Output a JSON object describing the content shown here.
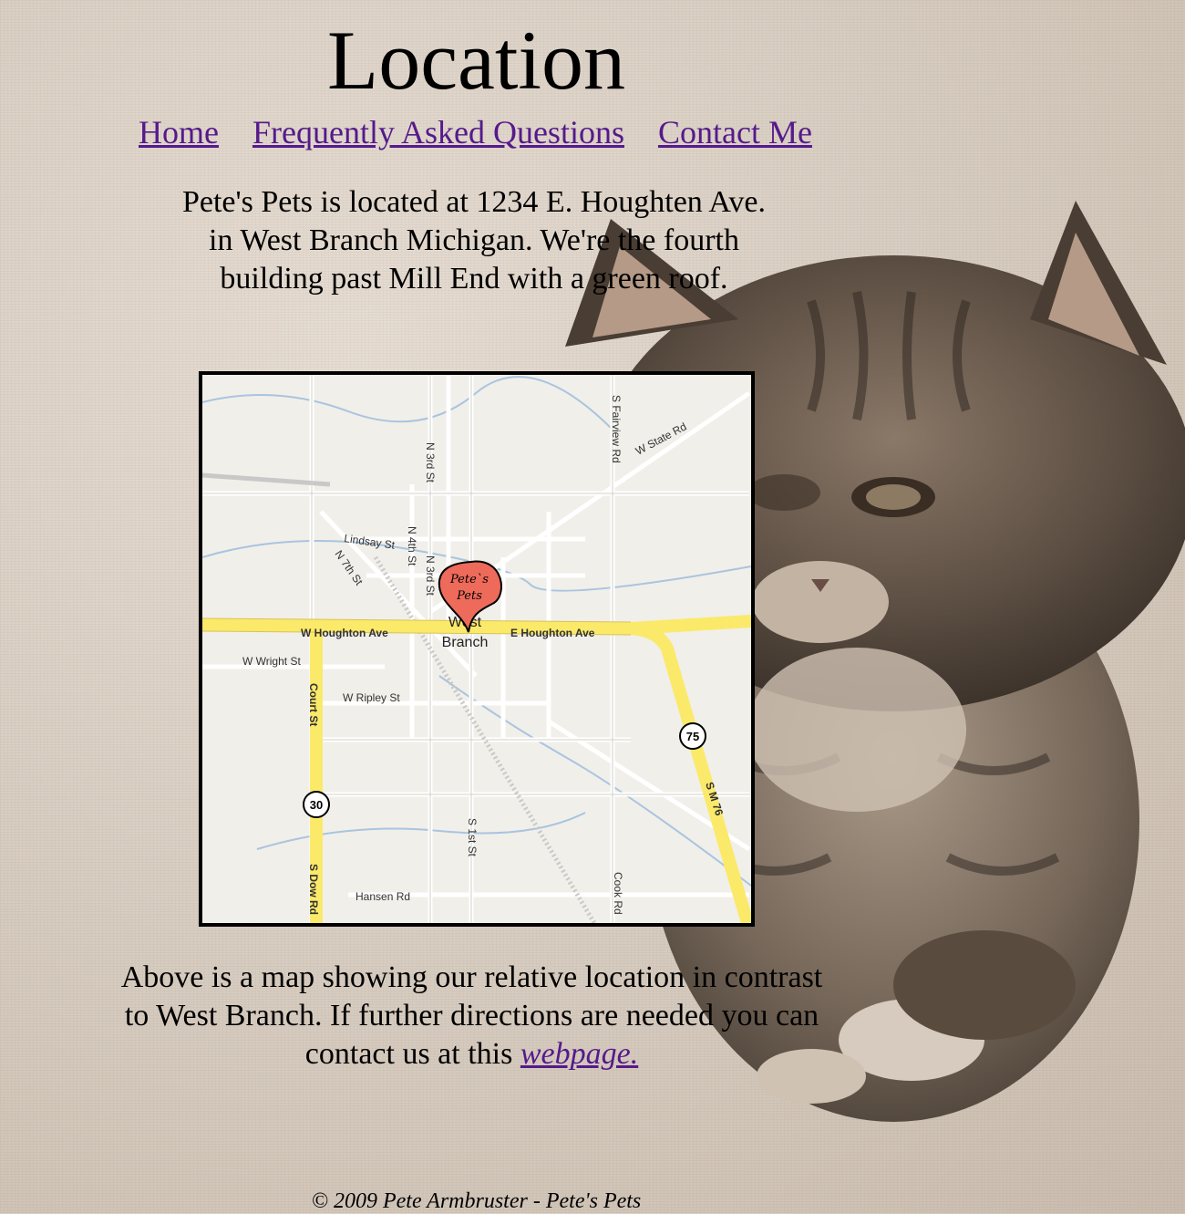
{
  "page": {
    "title": "Location"
  },
  "nav": [
    {
      "label": "Home"
    },
    {
      "label": "Frequently Asked Questions"
    },
    {
      "label": "Contact Me"
    }
  ],
  "intro": {
    "line1": "Pete's Pets is located at 1234 E. Houghten Ave.",
    "line2": "in West Branch Michigan. We're the fourth",
    "line3": "building past Mill End with a green roof."
  },
  "map": {
    "marker_line1": "Pete`s",
    "marker_line2": "Pets",
    "town_line1": "West",
    "town_line2": "Branch",
    "streets": {
      "w_houghton": "W Houghton Ave",
      "e_houghton": "E Houghton Ave",
      "lindsay": "Lindsay St",
      "n7th": "N 7th St",
      "n4th": "N 4th St",
      "n3rd_top": "N 3rd St",
      "n3rd": "N 3rd St",
      "fairview": "S Fairview Rd",
      "state": "W State Rd",
      "wright": "W Wright St",
      "ripley": "W Ripley St",
      "court": "Court St",
      "s1st": "S 1st St",
      "hansen": "Hansen Rd",
      "dow": "S Dow Rd",
      "cook": "Cook Rd",
      "m76": "S M 76"
    },
    "shield_30": "30",
    "shield_75": "75",
    "colors": {
      "highway": "#fbe96a",
      "road": "#ffffff",
      "water": "#a9c4e0",
      "marker": "#ee6a5a"
    }
  },
  "outro": {
    "line1": "Above is a map showing our relative location in contrast",
    "line2": "to West Branch. If further directions are needed you can",
    "line3_prefix": "contact us at this ",
    "link": "webpage."
  },
  "footer": "© 2009 Pete Armbruster - Pete's Pets"
}
